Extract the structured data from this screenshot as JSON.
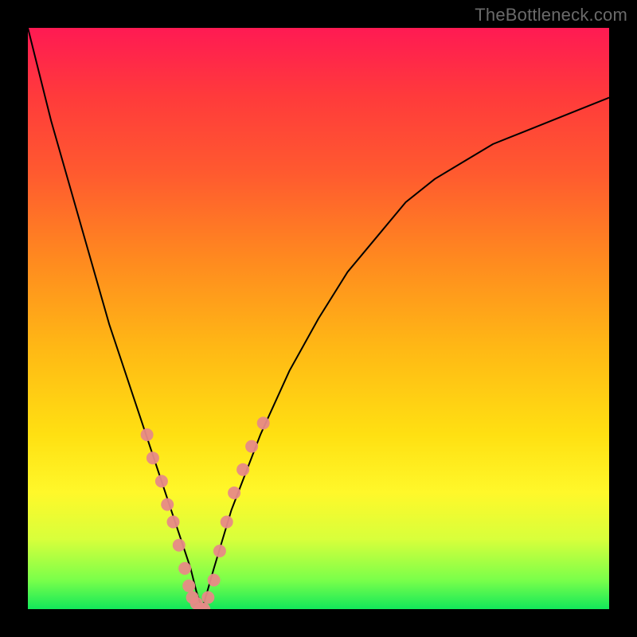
{
  "watermark": "TheBottleneck.com",
  "chart_data": {
    "type": "line",
    "title": "",
    "xlabel": "",
    "ylabel": "",
    "xlim": [
      0,
      100
    ],
    "ylim": [
      0,
      100
    ],
    "x": [
      0,
      2,
      4,
      6,
      8,
      10,
      12,
      14,
      16,
      18,
      20,
      22,
      24,
      26,
      28,
      29,
      30,
      32,
      35,
      40,
      45,
      50,
      55,
      60,
      65,
      70,
      75,
      80,
      85,
      90,
      95,
      100
    ],
    "y": [
      100,
      92,
      84,
      77,
      70,
      63,
      56,
      49,
      43,
      37,
      31,
      25,
      19,
      13,
      7,
      3,
      0,
      7,
      17,
      30,
      41,
      50,
      58,
      64,
      70,
      74,
      77,
      80,
      82,
      84,
      86,
      88
    ],
    "dots": {
      "left_branch": [
        {
          "x": 20.5,
          "y": 30
        },
        {
          "x": 21.5,
          "y": 26
        },
        {
          "x": 23.0,
          "y": 22
        },
        {
          "x": 24.0,
          "y": 18
        },
        {
          "x": 25.0,
          "y": 15
        },
        {
          "x": 26.0,
          "y": 11
        },
        {
          "x": 27.0,
          "y": 7
        },
        {
          "x": 27.7,
          "y": 4
        },
        {
          "x": 28.3,
          "y": 2
        },
        {
          "x": 29.0,
          "y": 1
        },
        {
          "x": 29.7,
          "y": 0
        },
        {
          "x": 30.3,
          "y": 0
        },
        {
          "x": 31.0,
          "y": 2
        }
      ],
      "right_branch": [
        {
          "x": 32.0,
          "y": 5
        },
        {
          "x": 33.0,
          "y": 10
        },
        {
          "x": 34.2,
          "y": 15
        },
        {
          "x": 35.5,
          "y": 20
        },
        {
          "x": 37.0,
          "y": 24
        },
        {
          "x": 38.5,
          "y": 28
        },
        {
          "x": 40.5,
          "y": 32
        }
      ]
    },
    "colors": {
      "curve": "#000000",
      "dots": "#e78a87",
      "gradient_top": "#ff1a53",
      "gradient_bottom": "#12e85a",
      "background": "#000000"
    }
  }
}
